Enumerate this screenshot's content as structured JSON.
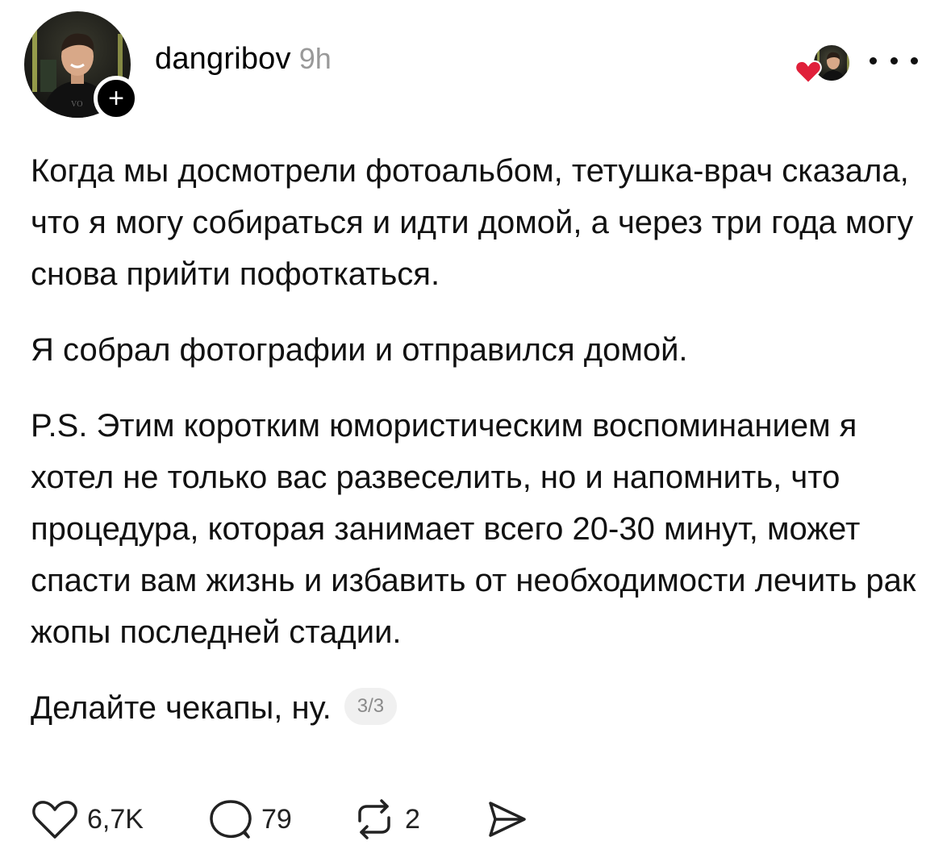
{
  "post": {
    "author": {
      "username": "dangribov",
      "time": "9h",
      "follow_symbol": "+"
    },
    "paragraphs": [
      "Когда мы досмотрели фотоальбом, тетушка-врач сказала, что я могу собираться и идти домой, а через три года могу снова прийти пофоткаться.",
      "Я собрал фотографии и отправился домой.",
      "P.S. Этим коротким юмористическим воспоминанием я хотел не только вас развеселить, но и напомнить, что процедура, которая занимает всего 20-30 минут, может спасти вам жизнь и избавить от необходимости лечить рак жопы последней стадии.",
      "Делайте чекапы, ну."
    ],
    "page_counter": "3/3",
    "stats": {
      "likes": "6,7K",
      "comments": "79",
      "reposts": "2"
    }
  },
  "icons": {
    "like": "heart-outline-icon",
    "comment": "comment-bubble-icon",
    "repost": "repost-arrows-icon",
    "share": "send-arrow-icon",
    "more": "more-dots-icon",
    "liked_by": "red-heart-icon"
  },
  "colors": {
    "text": "#111111",
    "muted": "#999999",
    "like_heart": "#e0203a",
    "counter_bg": "#f0f0f0"
  }
}
